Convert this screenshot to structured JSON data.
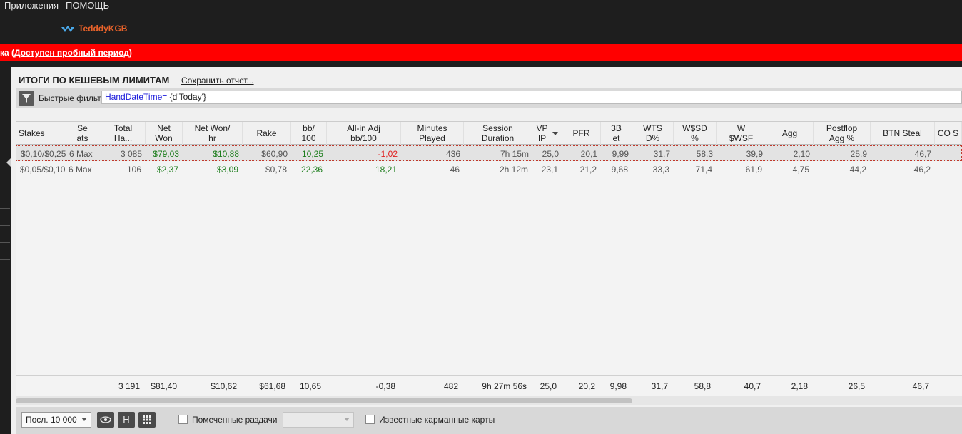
{
  "menu": {
    "apps": "Приложения",
    "help": "ПОМОЩЬ"
  },
  "user": {
    "name": "TedddyKGB"
  },
  "banner": {
    "prefix": "ка (",
    "link": "Доступен пробный период",
    "suffix": ")"
  },
  "panel": {
    "title": "ИТОГИ ПО КЕШЕВЫМ ЛИМИТАМ",
    "save_report": "Сохранить отчет..."
  },
  "filter": {
    "label": "Быстрые фильт",
    "keyword": "HandDateTime=",
    "value": " {d'Today'}"
  },
  "columns": [
    {
      "l1": "Stakes",
      "l2": ""
    },
    {
      "l1": "Se",
      "l2": "ats"
    },
    {
      "l1": "Total",
      "l2": "Ha..."
    },
    {
      "l1": "Net",
      "l2": "Won"
    },
    {
      "l1": "Net Won/",
      "l2": "hr"
    },
    {
      "l1": "Rake",
      "l2": ""
    },
    {
      "l1": "bb/",
      "l2": "100"
    },
    {
      "l1": "All-in Adj",
      "l2": "bb/100"
    },
    {
      "l1": "Minutes",
      "l2": "Played"
    },
    {
      "l1": "Session",
      "l2": "Duration"
    },
    {
      "l1": "VP",
      "l2": "IP"
    },
    {
      "l1": "PFR",
      "l2": ""
    },
    {
      "l1": "3B",
      "l2": "et"
    },
    {
      "l1": "WTS",
      "l2": "D%"
    },
    {
      "l1": "W$SD",
      "l2": "%"
    },
    {
      "l1": "W",
      "l2": "$WSF"
    },
    {
      "l1": "Agg",
      "l2": ""
    },
    {
      "l1": "Postflop",
      "l2": "Agg %"
    },
    {
      "l1": "BTN Steal",
      "l2": ""
    },
    {
      "l1": "CO S",
      "l2": ""
    }
  ],
  "rows": [
    [
      "$0,10/$0,25",
      "6 Max",
      "3 085",
      "$79,03",
      "$10,88",
      "$60,90",
      "10,25",
      "-1,02",
      "436",
      "7h 15m",
      "25,0",
      "20,1",
      "9,99",
      "31,7",
      "58,3",
      "39,9",
      "2,10",
      "25,9",
      "46,7"
    ],
    [
      "$0,05/$0,10",
      "6 Max",
      "106",
      "$2,37",
      "$3,09",
      "$0,78",
      "22,36",
      "18,21",
      "46",
      "2h 12m",
      "23,1",
      "21,2",
      "9,68",
      "33,3",
      "71,4",
      "61,9",
      "4,75",
      "44,2",
      "46,2"
    ]
  ],
  "totals": [
    "3 191",
    "$81,40",
    "$10,62",
    "$61,68",
    "10,65",
    "-0,38",
    "482",
    "9h 27m 56s",
    "25,0",
    "20,2",
    "9,98",
    "31,7",
    "58,8",
    "40,7",
    "2,18",
    "26,5",
    "46,7"
  ],
  "bottom": {
    "hands_select": "Посл. 10 000",
    "h_button": "H",
    "marked_hands": "Помеченные раздачи",
    "known_cards": "Известные карманные карты"
  },
  "colors": {
    "banner": "#ff0000",
    "positive": "#1c7d1c",
    "negative": "#e02020",
    "username": "#e8622a"
  }
}
